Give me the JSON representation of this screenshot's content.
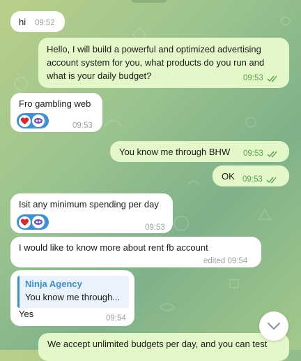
{
  "messages": [
    {
      "text": "hi",
      "time": "09:52",
      "direction": "in"
    },
    {
      "text": "Hello, I will build a powerful and optimized advertising",
      "line2": "account system for you, what products do you run and",
      "line3": "what is your daily budget?",
      "time": "09:53",
      "direction": "out",
      "status": "read"
    },
    {
      "text": "Fro gambling web",
      "time": "09:53",
      "direction": "in",
      "reaction": "heart"
    },
    {
      "text": "You know me through BHW",
      "time": "09:53",
      "direction": "out",
      "status": "read"
    },
    {
      "text": "OK",
      "time": "09:53",
      "direction": "out",
      "status": "read"
    },
    {
      "text": "Isit any minimum spending per day",
      "time": "09:53",
      "direction": "in",
      "reaction": "heart"
    },
    {
      "text": "I would like to know more about rent fb account",
      "time": "edited 09:54",
      "direction": "in"
    },
    {
      "reply_name": "Ninja Agency",
      "reply_text": "You know me through...",
      "text": "Yes",
      "time": "09:54",
      "direction": "in"
    },
    {
      "text": "We accept unlimited budgets per day, and you can test",
      "direction": "out"
    }
  ],
  "colors": {
    "incoming": "#ffffff",
    "outgoing": "#e4f7c9",
    "outgoing_meta": "#56a44a",
    "accent": "#3a8fd4"
  },
  "icons": {
    "read_status": "double-check-icon",
    "reaction": "red-heart-icon",
    "scroll": "chevron-down-icon"
  }
}
